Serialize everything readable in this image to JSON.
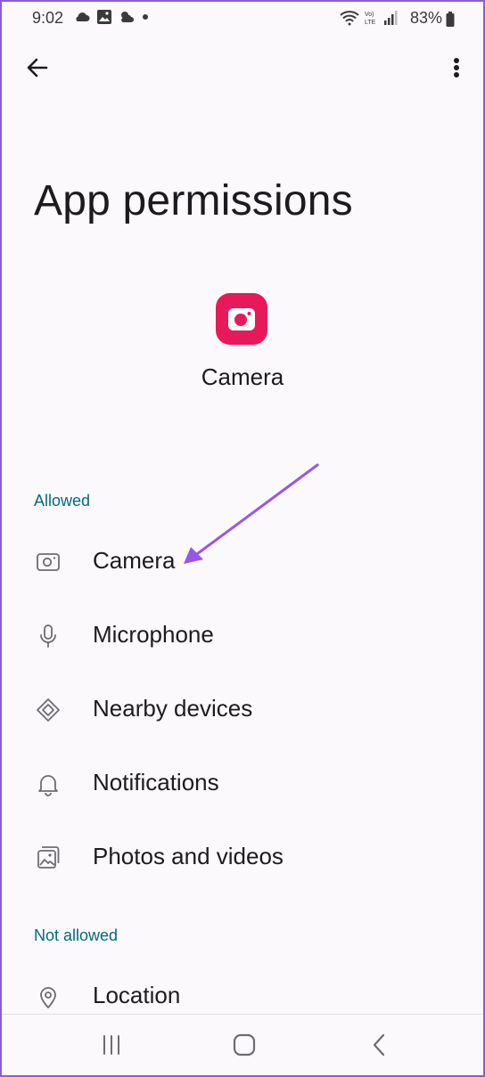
{
  "status_bar": {
    "time": "9:02",
    "battery": "83%",
    "left_icons": [
      "cloud-icon",
      "gallery-icon",
      "weather-icon",
      "dot-icon"
    ],
    "right_icons": [
      "wifi-icon",
      "volte-icon",
      "signal-icon",
      "battery-icon"
    ]
  },
  "header": {
    "title": "App permissions"
  },
  "app": {
    "name": "Camera",
    "icon_color": "#e8195a"
  },
  "sections": {
    "allowed": "Allowed",
    "not_allowed": "Not allowed"
  },
  "permissions": {
    "allowed": [
      {
        "label": "Camera",
        "icon": "camera-icon"
      },
      {
        "label": "Microphone",
        "icon": "microphone-icon"
      },
      {
        "label": "Nearby devices",
        "icon": "nearby-devices-icon"
      },
      {
        "label": "Notifications",
        "icon": "bell-icon"
      },
      {
        "label": "Photos and videos",
        "icon": "photos-icon"
      }
    ],
    "not_allowed": [
      {
        "label": "Location",
        "icon": "location-pin-icon"
      }
    ]
  },
  "colors": {
    "accent_section": "#006a82",
    "annotation_arrow": "#9b55e6",
    "frame_border": "#8b5cd6"
  }
}
